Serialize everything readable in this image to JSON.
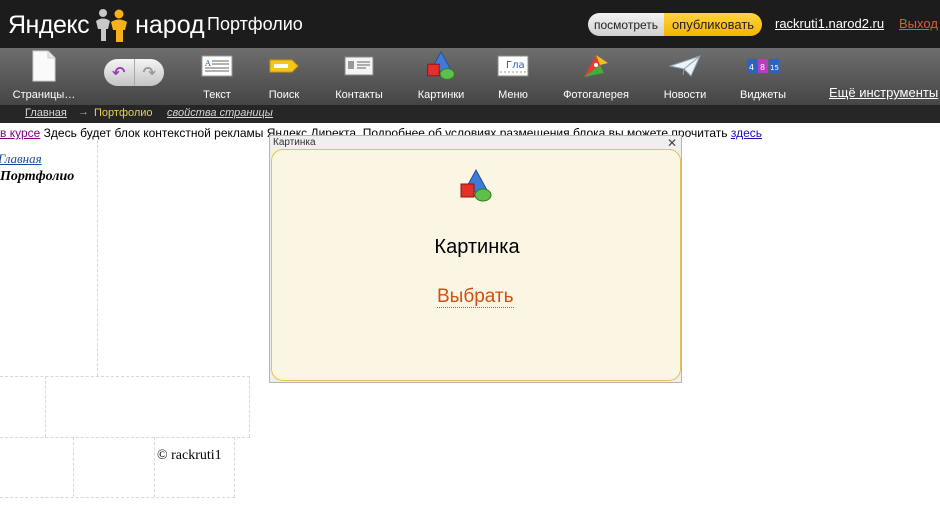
{
  "header": {
    "logo_yandex": "Яндекс",
    "logo_narod": "народ",
    "page_title": "Портфолио",
    "mode_view": "посмотреть",
    "mode_publish": "опубликовать",
    "site_link": "rackruti1.narod2.ru",
    "logout": "Выход"
  },
  "toolbar": {
    "items": [
      {
        "label": "Страницы…",
        "icon": "pages-icon"
      },
      {
        "label": "Текст",
        "icon": "text-icon"
      },
      {
        "label": "Поиск",
        "icon": "search-icon"
      },
      {
        "label": "Контакты",
        "icon": "contacts-icon"
      },
      {
        "label": "Картинки",
        "icon": "images-icon"
      },
      {
        "label": "Меню",
        "icon": "menu-icon"
      },
      {
        "label": "Фотогалерея",
        "icon": "photogallery-icon"
      },
      {
        "label": "Новости",
        "icon": "news-icon"
      },
      {
        "label": "Виджеты",
        "icon": "widgets-icon"
      }
    ],
    "menu_icon_text": "Гла",
    "widget_numbers": [
      "4",
      "8",
      "15"
    ],
    "more_tools": "Ещё инструменты"
  },
  "breadcrumb": {
    "home": "Главная",
    "arrow": "→",
    "current": "Портфолио",
    "page_props": "свойства страницы"
  },
  "content": {
    "ad_link_left": "в курсе",
    "ad_text": "Здесь будет блок контекстной рекламы Яндекс.Директа. Подробнее об условиях размещения блока вы можете прочитать",
    "ad_link_right": "здесь",
    "nav_home": "Главная",
    "nav_current": "Портфолио",
    "footer_copyright": "© rackruti1"
  },
  "dialog": {
    "title_bar": "Картинка",
    "close_glyph": "✕",
    "heading": "Картинка",
    "choose_link": "Выбрать"
  },
  "colors": {
    "header_bg": "#1c1c1c",
    "publish_yellow": "#f5b400",
    "logout_red": "#e25b3c",
    "dialog_bg": "#fbf6e4",
    "dialog_border": "#e1c44e",
    "choose_orange": "#d0500f"
  }
}
